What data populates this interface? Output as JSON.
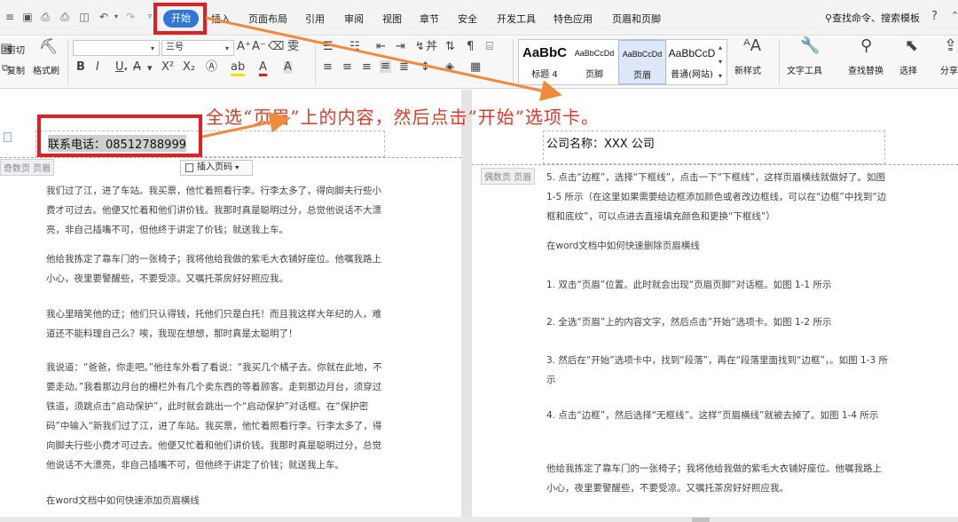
{
  "quick_access": {
    "icons": [
      "save-icon",
      "print-preview-icon",
      "print-icon",
      "export-pdf-icon",
      "undo-icon",
      "redo-icon",
      "customize-icon"
    ]
  },
  "menu": {
    "start": "开始",
    "items": [
      "插入",
      "页面布局",
      "引用",
      "审阅",
      "视图",
      "章节",
      "安全",
      "开发工具",
      "特色应用",
      "页眉和页脚"
    ],
    "search": "查找命令、搜索模板",
    "help": "?"
  },
  "ribbon": {
    "cut": "剪切",
    "copy": "复制",
    "format_painter": "格式刷",
    "font_name": "",
    "font_size": "三号",
    "bold": "B",
    "italic": "I",
    "underline": "U",
    "grow_font": "A⁺",
    "shrink_font": "A⁻",
    "styles": [
      {
        "sample": "AaBbC",
        "name": "标题 4"
      },
      {
        "sample": "AaBbCcDd",
        "name": "页脚"
      },
      {
        "sample": "AaBbCcDd",
        "name": "页眉"
      },
      {
        "sample": "AaBbCcD",
        "name": "普通(网站)"
      }
    ],
    "new_style": "新样式",
    "text_tools": "文字工具",
    "find_replace": "查找替换",
    "select": "选择",
    "share": "分享"
  },
  "annotation": {
    "instruction": "全选“页眉”上的内容，然后点击”开始”选项卡。"
  },
  "left_page": {
    "header_label": "奇数页 页眉",
    "header_text": "联系电话：08512788999",
    "insert_page_number": "插入页码",
    "paragraphs": [
      "我们过了江，进了车站。我买票，他忙着照看行李。行李太多了，得向脚夫行些小费才可过去。他便又忙着和他们讲价钱。我那时真是聪明过分，总觉他说话不大漂亮，非自己插嘴不可，但他终于讲定了价钱；就送我上车。",
      "他给我拣定了靠车门的一张椅子；我将他给我做的紫毛大衣铺好座位。他嘱我路上小心，夜里要警醒些，不要受凉。又嘱托茶房好好照应我。",
      "我心里暗笑他的迂；他们只认得钱，托他们只是白托！而且我这样大年纪的人，难道还不能料理自己么？唉，我现在想想，那时真是太聪明了！",
      "我说道：“爸爸，你走吧。”他往车外看了看说：“我买几个橘子去。你就在此地，不要走动。”我看那边月台的栅栏外有几个卖东西的等着顾客。走到那边月台，须穿过铁道，须跳点击“启动保护”，此时就会跳出一个“启动保护”对话框。在“保护密码”中输入“新我们过了江，进了车站。我买票，他忙着照看行李。行李太多了，得向脚夫行些小费才可过去。他便又忙着和他们讲价钱。我那时真是聪明过分，总觉他说话不大漂亮，非自己插嘴不可，但他终于讲定了价钱；就送我上车。",
      "在word文档中如何快速添加页眉横线"
    ]
  },
  "right_page": {
    "header_label": "偶数页 页眉",
    "header_text": "公司名称：XXX 公司",
    "paragraphs": [
      "5. 点击“边框”，选择“下框线”，点击一下“下框线”，这样页眉横线就做好了。如图 1-5 所示（在这里如果需要给边框添加颜色或者改边框线，可以在“边框”中找到“边框和底纹”，可以点进去直接填充颜色和更换“下框线”）",
      "在word文档中如何快速删除页眉横线",
      "1. 双击“页眉”位置。此时就会出现“页眉页脚”对话框。如图 1-1 所示",
      "2. 全选“页眉”上的内容文字，然后点击”开始”选项卡。如图 1-2 所示",
      "3. 然后在“开始”选项卡中，找到“段落”，再在“段落里面找到“边框”，。如图 1-3 所示",
      "4. 点击“边框”，然后选择“无框线”。这样“页眉横线”就被去掉了。如图 1-4 所示",
      "他给我拣定了靠车门的一张椅子；我将他给我做的紫毛大衣铺好座位。他嘱我路上小心，夜里要警醒些，不要受凉。又嘱托茶房好好照应我。"
    ]
  },
  "colors": {
    "accent": "#2f78d8",
    "annotation": "#e03a2a",
    "arrow": "#f08a3c",
    "highlight_box": "#e02020"
  }
}
